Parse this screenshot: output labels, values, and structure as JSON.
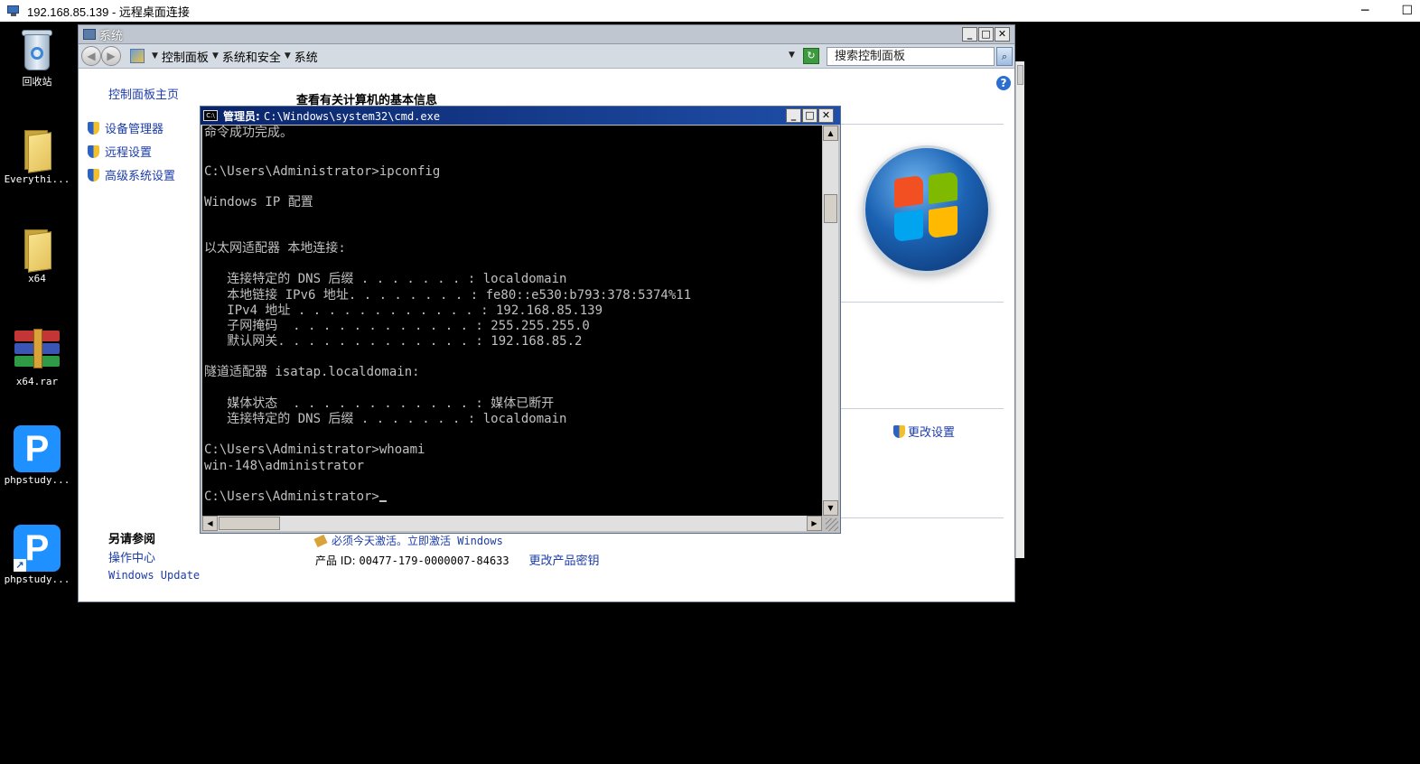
{
  "rdp": {
    "title": "192.168.85.139 - 远程桌面连接",
    "minimize": "─",
    "maximize": "☐"
  },
  "desktop": {
    "icons": [
      {
        "label": "回收站",
        "icon": "recycle-bin-icon"
      },
      {
        "label": "Everythi...",
        "icon": "folder-icon"
      },
      {
        "label": "x64",
        "icon": "folder-icon"
      },
      {
        "label": "x64.rar",
        "icon": "winrar-archive-icon"
      },
      {
        "label": "phpstudy...",
        "icon": "phpstudy-icon"
      },
      {
        "label": "phpstudy...",
        "icon": "phpstudy-shortcut-icon"
      }
    ]
  },
  "system_window": {
    "title": "系统",
    "breadcrumbs": [
      "控制面板",
      "系统和安全",
      "系统"
    ],
    "search_placeholder": "搜索控制面板",
    "heading": "查看有关计算机的基本信息",
    "sidebar_home": "控制面板主页",
    "sidebar_links": [
      "设备管理器",
      "远程设置",
      "高级系统设置"
    ],
    "see_also_title": "另请参阅",
    "see_also_links": [
      "操作中心",
      "Windows Update"
    ],
    "change_settings": "更改设置",
    "activation_text": "必须今天激活。立即激活 Windows",
    "product_id_label": "产品 ID:",
    "product_id": "00477-179-0000007-84633",
    "change_key": "更改产品密钥"
  },
  "cmd_window": {
    "title_prefix": "管理员:",
    "title_path": "C:\\Windows\\system32\\cmd.exe",
    "lines": [
      "命令成功完成。",
      "",
      "C:\\Users\\Administrator>ipconfig",
      "",
      "Windows IP 配置",
      "",
      "",
      "以太网适配器 本地连接:",
      "",
      "   连接特定的 DNS 后缀 . . . . . . . : localdomain",
      "   本地链接 IPv6 地址. . . . . . . . : fe80::e530:b793:378:5374%11",
      "   IPv4 地址 . . . . . . . . . . . . : 192.168.85.139",
      "   子网掩码  . . . . . . . . . . . . : 255.255.255.0",
      "   默认网关. . . . . . . . . . . . . : 192.168.85.2",
      "",
      "隧道适配器 isatap.localdomain:",
      "",
      "   媒体状态  . . . . . . . . . . . . : 媒体已断开",
      "   连接特定的 DNS 后缀 . . . . . . . : localdomain",
      "",
      "C:\\Users\\Administrator>whoami",
      "win-148\\administrator",
      "",
      "C:\\Users\\Administrator>"
    ]
  }
}
